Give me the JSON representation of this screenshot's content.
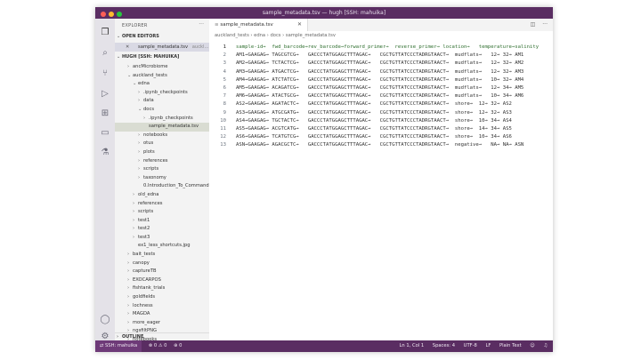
{
  "window": {
    "title": "sample_metadata.tsv — hugh [SSH: mahuika]",
    "traffic_lights": [
      "#ff5f57",
      "#febc2e",
      "#28c840"
    ]
  },
  "activity_bar": [
    "files-icon",
    "search-icon",
    "source-control-icon",
    "run-debug-icon",
    "extensions-icon",
    "remote-explorer-icon",
    "testing-icon",
    "account-icon",
    "settings-gear-icon"
  ],
  "sidebar": {
    "header": "EXPLORER",
    "more_glyph": "···",
    "open_editors_label": "OPEN EDITORS",
    "open_editor_file": "sample_metadata.tsv",
    "open_editor_path": "auckl...",
    "workspace_label": "HUGH [SSH: MAHUIKA]",
    "tree": [
      {
        "label": "ancMicrobiome",
        "chev": "›"
      },
      {
        "label": "auckland_tests",
        "chev": "⌄"
      },
      {
        "label": "edna",
        "chev": "⌄"
      },
      {
        "label": ".ipynb_checkpoints",
        "chev": "›"
      },
      {
        "label": "data",
        "chev": "›"
      },
      {
        "label": "docs",
        "chev": "⌄"
      },
      {
        "label": ".ipynb_checkpoints",
        "chev": "›"
      },
      {
        "label": "sample_metadata.tsv",
        "chev": ""
      },
      {
        "label": "notebooks",
        "chev": "›"
      },
      {
        "label": "otus",
        "chev": "›"
      },
      {
        "label": "plots",
        "chev": "›"
      },
      {
        "label": "references",
        "chev": "›"
      },
      {
        "label": "scripts",
        "chev": "›"
      },
      {
        "label": "taxonomy",
        "chev": "›"
      },
      {
        "label": "0.Introduction_To_CommandL...",
        "chev": ""
      },
      {
        "label": "old_edna",
        "chev": "›"
      },
      {
        "label": "references",
        "chev": "›"
      },
      {
        "label": "scripts",
        "chev": "›"
      },
      {
        "label": "test1",
        "chev": "›"
      },
      {
        "label": "test2",
        "chev": "›"
      },
      {
        "label": "test3",
        "chev": "›"
      },
      {
        "label": "ex1_less_shortcuts.jpg",
        "chev": ""
      },
      {
        "label": "bait_tests",
        "chev": "›"
      },
      {
        "label": "canopy",
        "chev": "›"
      },
      {
        "label": "captureTB",
        "chev": "›"
      },
      {
        "label": "EXOCARPOS",
        "chev": "›"
      },
      {
        "label": "fishtank_trials",
        "chev": "›"
      },
      {
        "label": "goldfields",
        "chev": "›"
      },
      {
        "label": "lochness",
        "chev": "›"
      },
      {
        "label": "MAGDA",
        "chev": "›"
      },
      {
        "label": "more_eager",
        "chev": "›"
      },
      {
        "label": "ngsfiltPNG",
        "chev": "›"
      },
      {
        "label": "notebooks",
        "chev": "›"
      }
    ],
    "outline_label": "OUTLINE"
  },
  "editor": {
    "tab_label": "sample_metadata.tsv",
    "breadcrumb": "auckland_tests  ›  edna  ›  docs  ›  sample_metadata.tsv",
    "lines": [
      "sample-id→  fwd_barcode→rev_barcode→forward_primer→  reverse_primer→ location→   temperature→salinity",
      "AM1→GAAGAG→ TAGCGTCG→   GACCCTATGGAGCTTTAGAC→   CGCTGTTATCCCTADRGTAACT→  mudflats→   12→ 32→ AM1",
      "AM2→GAAGAG→ TCTACTCG→   GACCCTATGGAGCTTTAGAC→   CGCTGTTATCCCTADRGTAACT→  mudflats→   12→ 32→ AM2",
      "AM3→GAAGAG→ ATGACTCG→   GACCCTATGGAGCTTTAGAC→   CGCTGTTATCCCTADRGTAACT→  mudflats→   12→ 32→ AM3",
      "AM4→GAAGAG→ ATCTATCG→   GACCCTATGGAGCTTTAGAC→   CGCTGTTATCCCTADRGTAACT→  mudflats→   10→ 32→ AM4",
      "AM5→GAAGAG→ ACAGATCG→   GACCCTATGGAGCTTTAGAC→   CGCTGTTATCCCTADRGTAACT→  mudflats→   12→ 34→ AM5",
      "AM6→GAAGAG→ ATACTGCG→   GACCCTATGGAGCTTTAGAC→   CGCTGTTATCCCTADRGTAACT→  mudflats→   10→ 34→ AM6",
      "AS2→GAAGAG→ AGATACTC→   GACCCTATGGAGCTTTAGAC→   CGCTGTTATCCCTADRGTAACT→  shore→  12→ 32→ AS2",
      "AS3→GAAGAG→ ATGCGATG→   GACCCTATGGAGCTTTAGAC→   CGCTGTTATCCCTADRGTAACT→  shore→  12→ 32→ AS3",
      "AS4→GAAGAG→ TGCTACTC→   GACCCTATGGAGCTTTAGAC→   CGCTGTTATCCCTADRGTAACT→  shore→  10→ 34→ AS4",
      "AS5→GAAGAG→ ACGTCATG→   GACCCTATGGAGCTTTAGAC→   CGCTGTTATCCCTADRGTAACT→  shore→  14→ 34→ AS5",
      "AS6→GAAGAG→ TCATGTCG→   GACCCTATGGAGCTTTAGAC→   CGCTGTTATCCCTADRGTAACT→  shore→  10→ 34→ AS6",
      "ASN→GAAGAG→ AGACGCTC→   GACCCTATGGAGCTTTAGAC→   CGCTGTTATCCCTADRGTAACT→  negative→   NA→ NA→ ASN"
    ]
  },
  "status_bar": {
    "remote": "⇄ SSH: mahuika",
    "problems": "⊗ 0 ⚠ 0",
    "ports": "⊕ 0",
    "position": "Ln 1, Col 1",
    "spaces": "Spaces: 4",
    "encoding": "UTF-8",
    "eol": "LF",
    "language": "Plain Text"
  }
}
